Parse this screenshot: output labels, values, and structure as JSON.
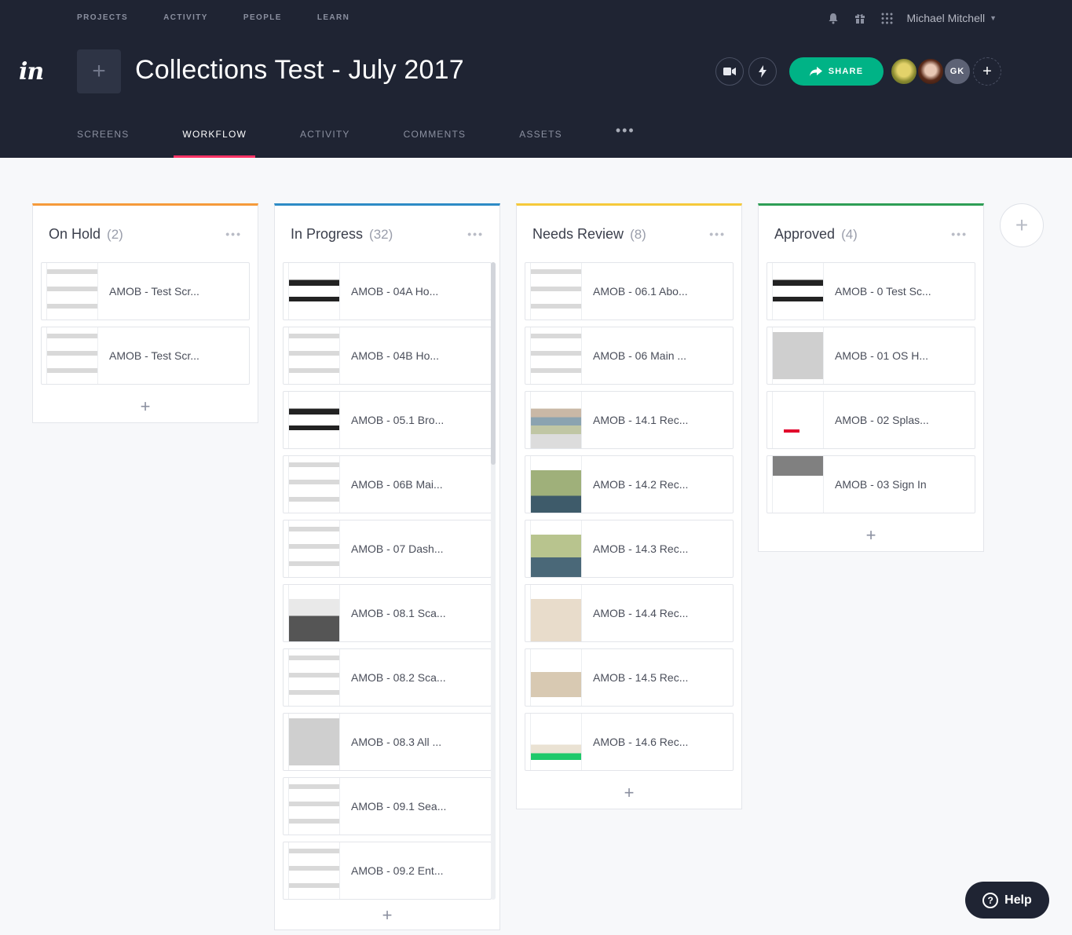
{
  "topnav": [
    "PROJECTS",
    "ACTIVITY",
    "PEOPLE",
    "LEARN"
  ],
  "user": {
    "name": "Michael Mitchell"
  },
  "logo_text": "in",
  "project": {
    "title": "Collections Test - July 2017"
  },
  "share_label": "SHARE",
  "avatar_initials": "GK",
  "tabs": [
    "SCREENS",
    "WORKFLOW",
    "ACTIVITY",
    "COMMENTS",
    "ASSETS"
  ],
  "active_tab": "WORKFLOW",
  "columns": [
    {
      "title": "On Hold",
      "count": "(2)",
      "color": "#f59a3a",
      "cards": [
        "AMOB - Test Scr...",
        "AMOB - Test Scr..."
      ]
    },
    {
      "title": "In Progress",
      "count": "(32)",
      "color": "#2d8bc6",
      "cards": [
        "AMOB - 04A Ho...",
        "AMOB - 04B Ho...",
        "AMOB - 05.1 Bro...",
        "AMOB - 06B Mai...",
        "AMOB - 07 Dash...",
        "AMOB - 08.1 Sca...",
        "AMOB - 08.2 Sca...",
        "AMOB - 08.3 All ...",
        "AMOB - 09.1 Sea...",
        "AMOB - 09.2 Ent..."
      ]
    },
    {
      "title": "Needs Review",
      "count": "(8)",
      "color": "#f5c93a",
      "cards": [
        "AMOB - 06.1 Abo...",
        "AMOB - 06 Main ...",
        "AMOB - 14.1 Rec...",
        "AMOB - 14.2 Rec...",
        "AMOB - 14.3 Rec...",
        "AMOB - 14.4 Rec...",
        "AMOB - 14.5 Rec...",
        "AMOB - 14.6 Rec..."
      ]
    },
    {
      "title": "Approved",
      "count": "(4)",
      "color": "#2e9e55",
      "cards": [
        "AMOB - 0 Test Sc...",
        "AMOB - 01 OS H...",
        "AMOB - 02 Splas...",
        "AMOB - 03 Sign In"
      ]
    }
  ],
  "help_label": "Help",
  "colors": {
    "header_bg": "#1f2433",
    "accent_pink": "#ff3366",
    "share_green": "#00b386"
  },
  "icons": [
    "bell-icon",
    "gift-icon",
    "apps-grid-icon",
    "video-icon",
    "lightning-icon",
    "share-arrow-icon",
    "plus-icon",
    "more-dots-icon",
    "help-icon"
  ]
}
